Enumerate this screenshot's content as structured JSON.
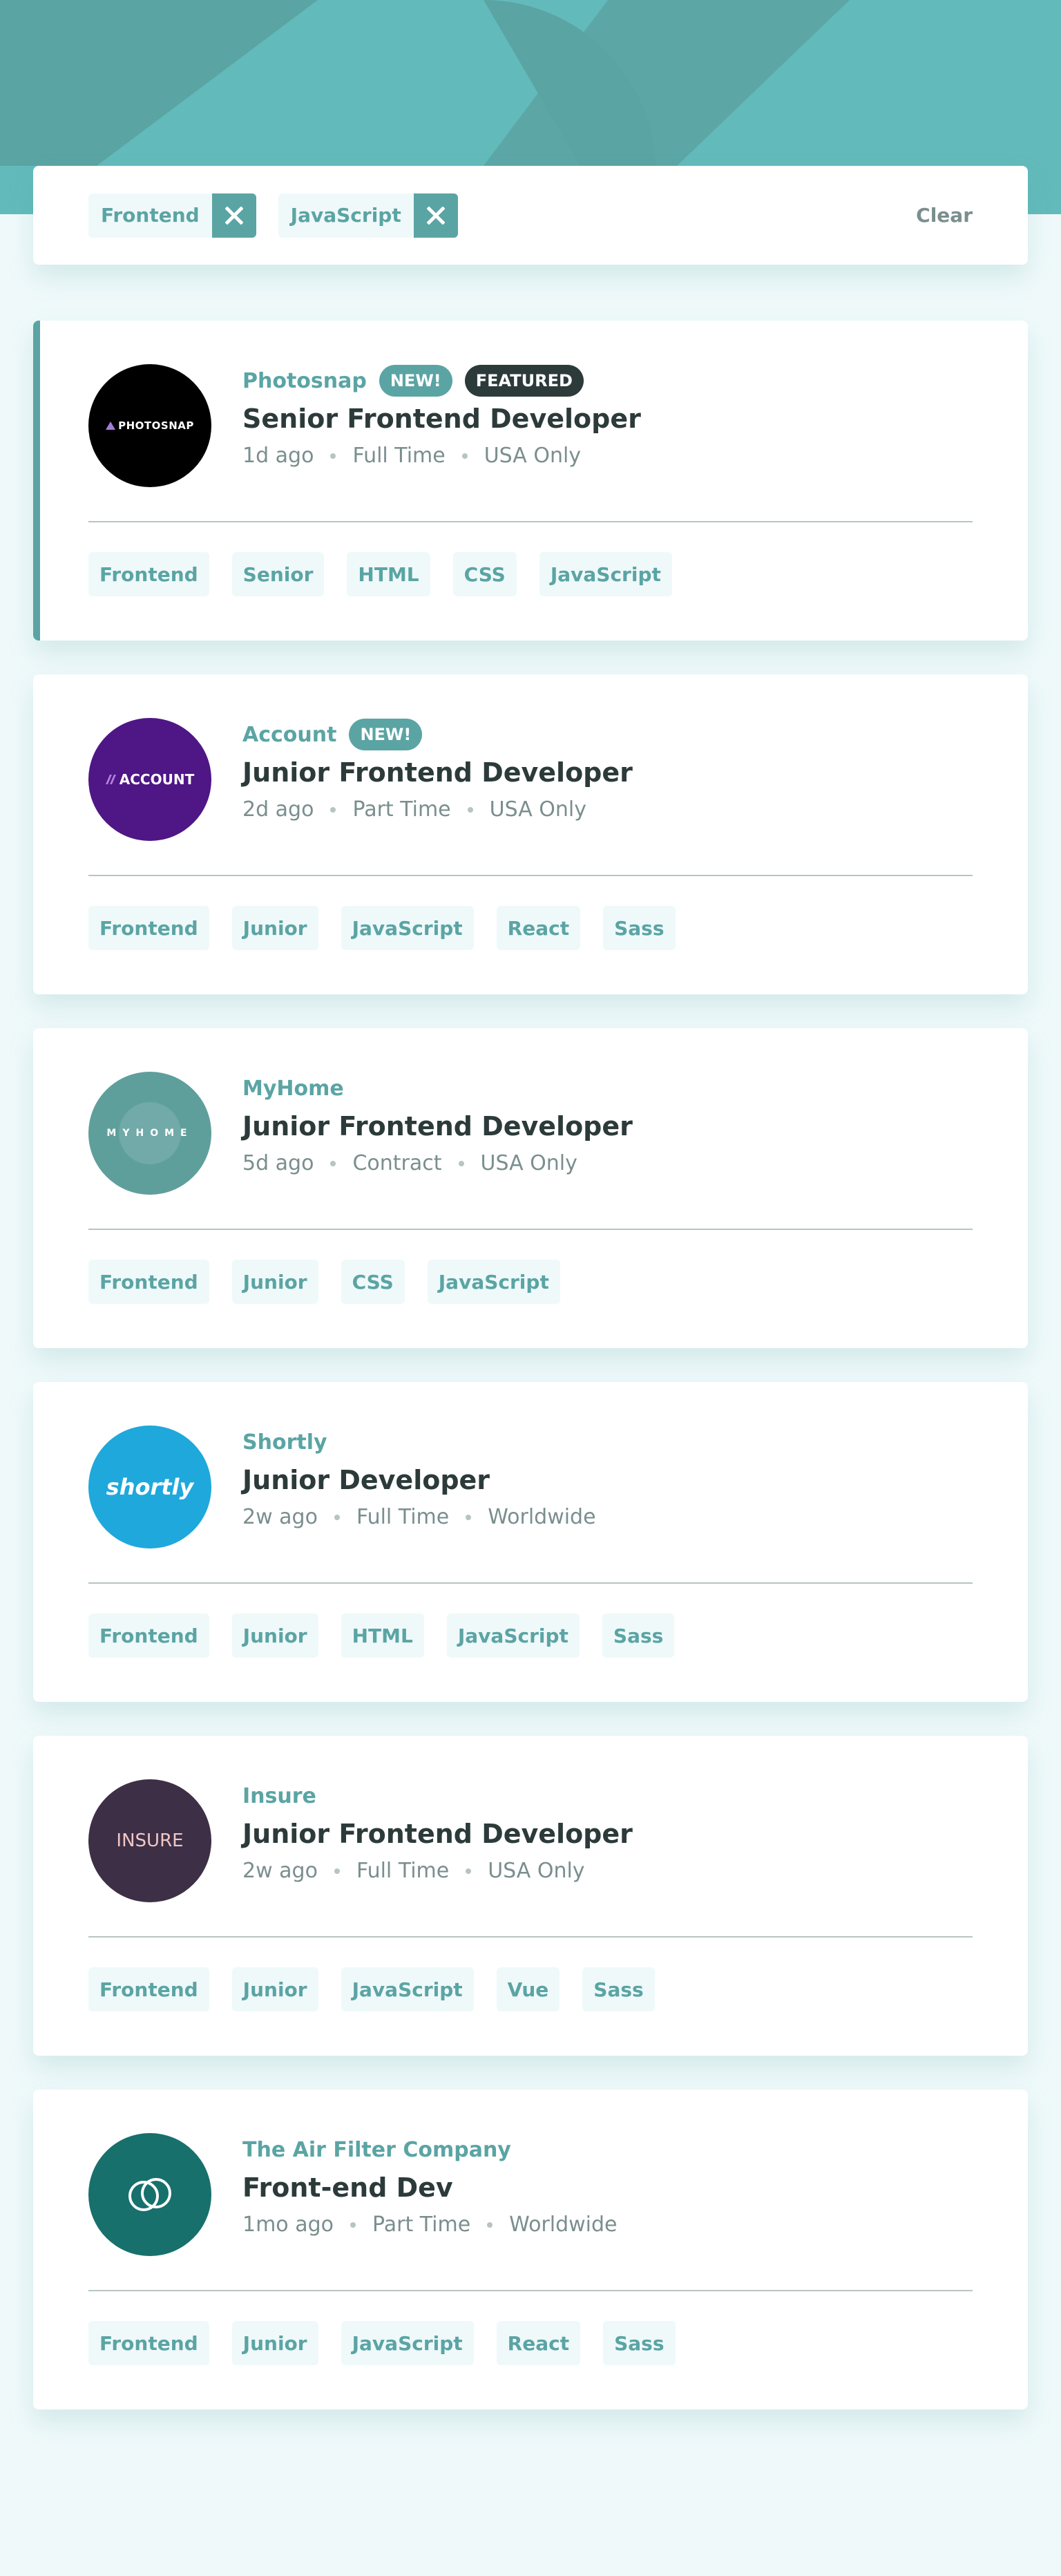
{
  "filters": {
    "active": [
      "Frontend",
      "JavaScript"
    ],
    "clear_label": "Clear"
  },
  "jobs": [
    {
      "company": "Photosnap",
      "new": "NEW!",
      "featured": "FEATURED",
      "position": "Senior Frontend Developer",
      "posted": "1d ago",
      "contract": "Full Time",
      "location": "USA Only",
      "logo_text": "PHOTOSNAP",
      "logo_color": "#000000",
      "tags": [
        "Frontend",
        "Senior",
        "HTML",
        "CSS",
        "JavaScript"
      ]
    },
    {
      "company": "Account",
      "new": "NEW!",
      "position": "Junior Frontend Developer",
      "posted": "2d ago",
      "contract": "Part Time",
      "location": "USA Only",
      "logo_text": "ACCOUNT",
      "logo_color": "#4f1685",
      "tags": [
        "Frontend",
        "Junior",
        "JavaScript",
        "React",
        "Sass"
      ]
    },
    {
      "company": "MyHome",
      "position": "Junior Frontend Developer",
      "posted": "5d ago",
      "contract": "Contract",
      "location": "USA Only",
      "logo_text": "MYHOME",
      "logo_color": "#5e9f9c",
      "tags": [
        "Frontend",
        "Junior",
        "CSS",
        "JavaScript"
      ]
    },
    {
      "company": "Shortly",
      "position": "Junior Developer",
      "posted": "2w ago",
      "contract": "Full Time",
      "location": "Worldwide",
      "logo_text": "shortly",
      "logo_color": "#1fa8dc",
      "tags": [
        "Frontend",
        "Junior",
        "HTML",
        "JavaScript",
        "Sass"
      ]
    },
    {
      "company": "Insure",
      "position": "Junior Frontend Developer",
      "posted": "2w ago",
      "contract": "Full Time",
      "location": "USA Only",
      "logo_text": "INSURE",
      "logo_color": "#3d2f45",
      "tags": [
        "Frontend",
        "Junior",
        "JavaScript",
        "Vue",
        "Sass"
      ]
    },
    {
      "company": "The Air Filter Company",
      "position": "Front-end Dev",
      "posted": "1mo ago",
      "contract": "Part Time",
      "location": "Worldwide",
      "logo_color": "#17706c",
      "tags": [
        "Frontend",
        "Junior",
        "JavaScript",
        "React",
        "Sass"
      ]
    }
  ]
}
